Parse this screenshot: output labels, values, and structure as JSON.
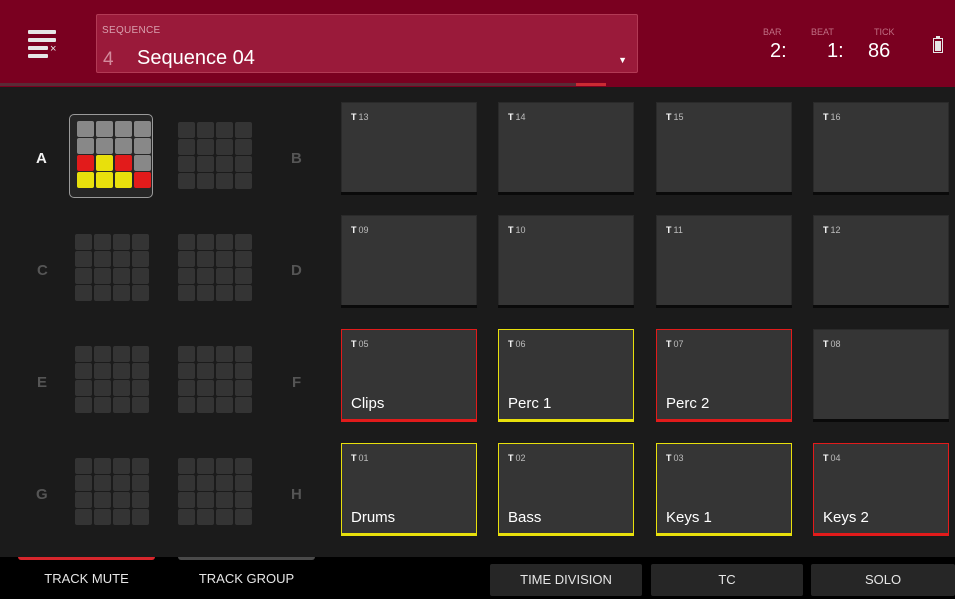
{
  "header": {
    "sequence_caption": "SEQUENCE",
    "sequence_number": "4",
    "sequence_name": "Sequence 04",
    "bar_caption": "BAR",
    "bar_value": "2:",
    "beat_caption": "BEAT",
    "beat_value": "1:",
    "tick_caption": "TICK",
    "tick_value": "86"
  },
  "banks": {
    "letters": [
      "A",
      "B",
      "C",
      "D",
      "E",
      "F",
      "G",
      "H"
    ],
    "active": "A",
    "active_cell_colors": [
      "#888888",
      "#888888",
      "#888888",
      "#888888",
      "#888888",
      "#888888",
      "#888888",
      "#888888",
      "#e21b1b",
      "#e8e00c",
      "#e21b1b",
      "#888888",
      "#e8e00c",
      "#e8e00c",
      "#e8e00c",
      "#e21b1b"
    ]
  },
  "tracks": [
    {
      "prefix": "T",
      "num": "13",
      "name": "",
      "color": "none"
    },
    {
      "prefix": "T",
      "num": "14",
      "name": "",
      "color": "none"
    },
    {
      "prefix": "T",
      "num": "15",
      "name": "",
      "color": "none"
    },
    {
      "prefix": "T",
      "num": "16",
      "name": "",
      "color": "none"
    },
    {
      "prefix": "T",
      "num": "09",
      "name": "",
      "color": "none"
    },
    {
      "prefix": "T",
      "num": "10",
      "name": "",
      "color": "none"
    },
    {
      "prefix": "T",
      "num": "11",
      "name": "",
      "color": "none"
    },
    {
      "prefix": "T",
      "num": "12",
      "name": "",
      "color": "none"
    },
    {
      "prefix": "T",
      "num": "05",
      "name": "Clips",
      "color": "red"
    },
    {
      "prefix": "T",
      "num": "06",
      "name": "Perc 1",
      "color": "yellow"
    },
    {
      "prefix": "T",
      "num": "07",
      "name": "Perc 2",
      "color": "red"
    },
    {
      "prefix": "T",
      "num": "08",
      "name": "",
      "color": "none"
    },
    {
      "prefix": "T",
      "num": "01",
      "name": "Drums",
      "color": "yellow"
    },
    {
      "prefix": "T",
      "num": "02",
      "name": "Bass",
      "color": "yellow"
    },
    {
      "prefix": "T",
      "num": "03",
      "name": "Keys 1",
      "color": "yellow"
    },
    {
      "prefix": "T",
      "num": "04",
      "name": "Keys 2",
      "color": "red"
    }
  ],
  "footer": {
    "track_mute": "TRACK MUTE",
    "track_group": "TRACK GROUP",
    "time_division": "TIME DIVISION",
    "tc": "TC",
    "solo": "SOLO"
  },
  "colors": {
    "header_bg": "#7a0020",
    "sequence_box": "#9a1a3a",
    "accent_red": "#e21b1b",
    "accent_yellow": "#e8e00c"
  }
}
